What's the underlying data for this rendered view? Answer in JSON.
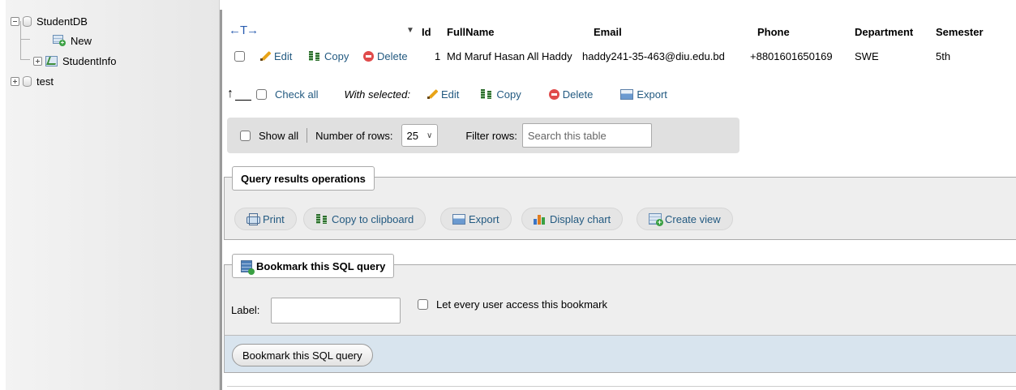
{
  "navigation": {
    "tree": [
      {
        "label": "StudentDB",
        "type": "database",
        "expanded": true
      },
      {
        "label": "New",
        "type": "new-table"
      },
      {
        "label": "StudentInfo",
        "type": "view"
      },
      {
        "label": "test",
        "type": "database",
        "expanded": false
      }
    ]
  },
  "results": {
    "sort_arrows": "←T→",
    "columns": [
      "Id",
      "FullName",
      "Email",
      "Phone",
      "Department",
      "Semester"
    ],
    "row_actions": {
      "edit": "Edit",
      "copy": "Copy",
      "delete": "Delete"
    },
    "rows": [
      {
        "id": "1",
        "fullname": "Md Maruf Hasan All Haddy",
        "email": "haddy241-35-463@diu.edu.bd",
        "phone": "+8801601650169",
        "department": "SWE",
        "semester": "5th"
      }
    ]
  },
  "bulk_actions": {
    "check_all": "Check all",
    "with_selected": "With selected:",
    "edit": "Edit",
    "copy": "Copy",
    "delete": "Delete",
    "export": "Export"
  },
  "nav_controls": {
    "show_all": "Show all",
    "number_of_rows_label": "Number of rows:",
    "number_of_rows_value": "25",
    "filter_rows_label": "Filter rows:",
    "filter_placeholder": "Search this table"
  },
  "query_ops": {
    "legend": "Query results operations",
    "print": "Print",
    "copy_to_clipboard": "Copy to clipboard",
    "export": "Export",
    "display_chart": "Display chart",
    "create_view": "Create view"
  },
  "bookmark": {
    "legend": "Bookmark this SQL query",
    "label_text": "Label:",
    "label_value": "",
    "share_text": "Let every user access this bookmark",
    "submit": "Bookmark this SQL query"
  },
  "colors": {
    "link": "#235a81",
    "panel_bg": "#eeeeee",
    "footer_bg": "#d8e4ee",
    "delete_red": "#e04b4b"
  }
}
